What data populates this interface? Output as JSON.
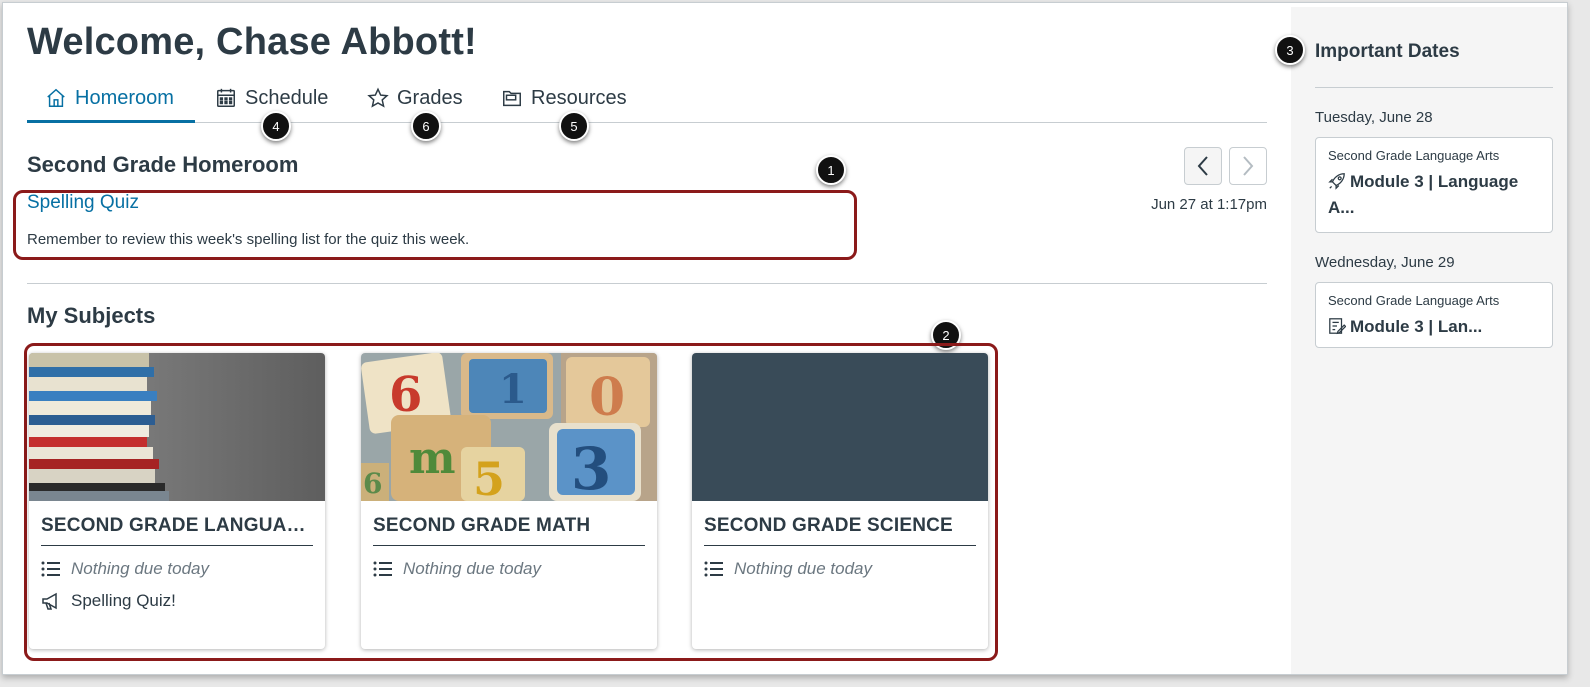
{
  "header": {
    "welcome": "Welcome, Chase Abbott!"
  },
  "tabs": [
    {
      "label": "Homeroom",
      "icon": "home-icon",
      "active": true
    },
    {
      "label": "Schedule",
      "icon": "calendar-icon",
      "active": false
    },
    {
      "label": "Grades",
      "icon": "star-icon",
      "active": false
    },
    {
      "label": "Resources",
      "icon": "folder-icon",
      "active": false
    }
  ],
  "callouts": [
    "1",
    "2",
    "3",
    "4",
    "5",
    "6"
  ],
  "homeroom": {
    "title": "Second Grade Homeroom",
    "announcement": {
      "title": "Spelling Quiz",
      "date": "Jun 27 at 1:17pm",
      "body": "Remember to review this week's spelling list for the quiz this week."
    }
  },
  "subjects": {
    "title": "My Subjects",
    "cards": [
      {
        "title": "SECOND GRADE LANGUAG...",
        "status": "Nothing due today",
        "extra": "Spelling Quiz!",
        "image": "books-photo"
      },
      {
        "title": "SECOND GRADE MATH",
        "status": "Nothing due today",
        "image": "number-blocks-photo"
      },
      {
        "title": "SECOND GRADE SCIENCE",
        "status": "Nothing due today",
        "image": "solid-color",
        "color": "#394b58"
      }
    ]
  },
  "important_dates": {
    "title": "Important Dates",
    "days": [
      {
        "date": "Tuesday, June 28",
        "course": "Second Grade Language Arts",
        "item_line1": "Module 3 | Language",
        "item_line2": "A...",
        "icon": "rocket-icon"
      },
      {
        "date": "Wednesday, June 29",
        "course": "Second Grade Language Arts",
        "item_line1": "Module 3 | Lan...",
        "icon": "assignment-icon"
      }
    ]
  },
  "colors": {
    "accent": "#0770a3",
    "text": "#2d3b45",
    "highlight": "#8b1a1a",
    "sidebar_bg": "#f5f5f5"
  }
}
